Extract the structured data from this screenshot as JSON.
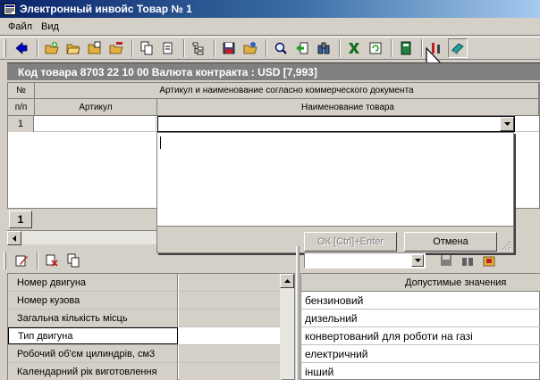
{
  "window": {
    "title": "Электронный инвойс  Товар № 1"
  },
  "menu": {
    "items": [
      {
        "label": "Файл"
      },
      {
        "label": "Вид"
      }
    ]
  },
  "toolbar": {
    "buttons": [
      {
        "icon": "back-arrow-icon"
      },
      {
        "icon": "folder-add-icon"
      },
      {
        "icon": "folder-open-icon"
      },
      {
        "icon": "folder-copy-icon"
      },
      {
        "icon": "folder-remove-icon"
      },
      {
        "icon": "copy-icon"
      },
      {
        "icon": "paste-icon"
      },
      {
        "icon": "tree-icon"
      },
      {
        "icon": "save-icon"
      },
      {
        "icon": "export-icon"
      },
      {
        "icon": "search-icon"
      },
      {
        "icon": "import-icon"
      },
      {
        "icon": "binoculars-icon"
      },
      {
        "icon": "excel-icon"
      },
      {
        "icon": "refresh-icon"
      },
      {
        "icon": "calculator-icon"
      },
      {
        "icon": "tools-icon"
      },
      {
        "icon": "book-icon"
      }
    ]
  },
  "info": {
    "text": "Код товара 8703 22 10 00 Валюта контракта : USD [7,993]"
  },
  "grid": {
    "col_num_top": "№",
    "col_num_bottom": "п/п",
    "group_header": "Артикул и наименование согласно коммерческого документа",
    "col_article": "Артикул",
    "col_name": "Наименование товара",
    "row_number": "1",
    "page": "1"
  },
  "dropdown": {
    "ok_label": "ОК  [Ctrl]+Enter",
    "cancel_label": "Отмена"
  },
  "properties": {
    "rows": [
      {
        "name": "Номер двигуна"
      },
      {
        "name": "Номер кузова"
      },
      {
        "name": "Загальна кількість місць"
      },
      {
        "name": "Тип двигуна"
      },
      {
        "name": "Робочий об'єм цилиндрів, см3"
      },
      {
        "name": "Календарний рік виготовлення"
      }
    ],
    "selected_index": 3
  },
  "values": {
    "header": "Допустимые значения",
    "items": [
      "бензиновий",
      "дизельний",
      "конвертований для роботи на газі",
      "електричний",
      "інший"
    ]
  },
  "colors": {
    "title_gradient_start": "#0a246a",
    "title_gradient_end": "#a6caf0",
    "info_bar": "#808080",
    "face": "#d4d0c8"
  }
}
